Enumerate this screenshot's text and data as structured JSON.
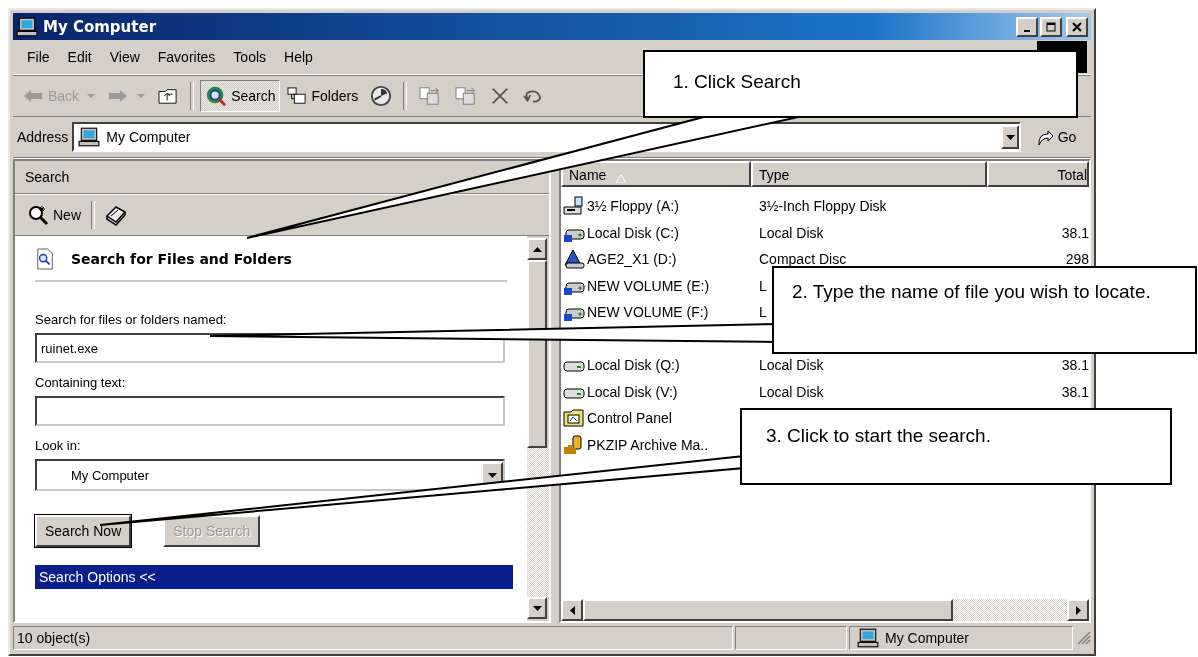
{
  "window": {
    "title": "My Computer"
  },
  "menu": [
    {
      "label": "File"
    },
    {
      "label": "Edit"
    },
    {
      "label": "View"
    },
    {
      "label": "Favorites"
    },
    {
      "label": "Tools"
    },
    {
      "label": "Help"
    }
  ],
  "toolbar": [
    {
      "kind": "back",
      "label": "Back",
      "disabled": true
    },
    {
      "kind": "forward",
      "disabled": true
    },
    {
      "kind": "up"
    },
    {
      "kind": "sep"
    },
    {
      "kind": "search",
      "label": "Search",
      "pressed": true
    },
    {
      "kind": "folders",
      "label": "Folders",
      "pressed": false
    },
    {
      "kind": "history"
    },
    {
      "kind": "sep"
    },
    {
      "kind": "move"
    },
    {
      "kind": "copy"
    },
    {
      "kind": "delete"
    },
    {
      "kind": "undo"
    }
  ],
  "address": {
    "label": "Address",
    "value": "My Computer",
    "go": "Go"
  },
  "search_pane": {
    "title": "Search",
    "new_label": "New",
    "heading": "Search for Files and Folders",
    "fields": [
      {
        "label": "Search for files or folders named:",
        "value": "ruinet.exe"
      },
      {
        "label": "Containing text:"
      }
    ],
    "look_in": {
      "label": "Look in:",
      "value": "My Computer"
    },
    "buttons": [
      {
        "label": "Search Now",
        "disabled": false
      },
      {
        "label": "Stop Search",
        "disabled": true
      }
    ],
    "options": "Search Options <<"
  },
  "file_list": {
    "columns": [
      {
        "label": "Name",
        "sorted": true
      },
      {
        "label": "Type",
        "sorted": false
      },
      {
        "label": "Total",
        "sorted": false
      }
    ],
    "rows": [
      {
        "kind": "floppy",
        "name": "3½ Floppy (A:)",
        "type": "3½-Inch Floppy Disk"
      },
      {
        "kind": "disk",
        "name": "Local Disk (C:)",
        "type": "Local Disk",
        "size": "38.1"
      },
      {
        "kind": "cd",
        "name": "AGE2_X1 (D:)",
        "type": "Compact Disc",
        "size": "298"
      },
      {
        "kind": "disk",
        "name": "NEW VOLUME (E:)",
        "type": "L"
      },
      {
        "kind": "disk",
        "name": "NEW VOLUME (F:)",
        "type": "L"
      },
      {
        "kind": "covered"
      },
      {
        "kind": "drive",
        "name": "Local Disk (Q:)",
        "type": "Local Disk",
        "size": "38.1"
      },
      {
        "kind": "drive",
        "name": "Local Disk (V:)",
        "type": "Local Disk",
        "size": "38.1"
      },
      {
        "kind": "control",
        "name": "Control Panel"
      },
      {
        "kind": "archive",
        "name": "PKZIP Archive Ma.."
      }
    ]
  },
  "status_bar": {
    "objects": "10 object(s)",
    "location": "My Computer"
  },
  "callouts": [
    {
      "text": "1. Click Search"
    },
    {
      "text": "2. Type the name of file you wish to locate."
    },
    {
      "text": "3. Click to start the search."
    }
  ]
}
